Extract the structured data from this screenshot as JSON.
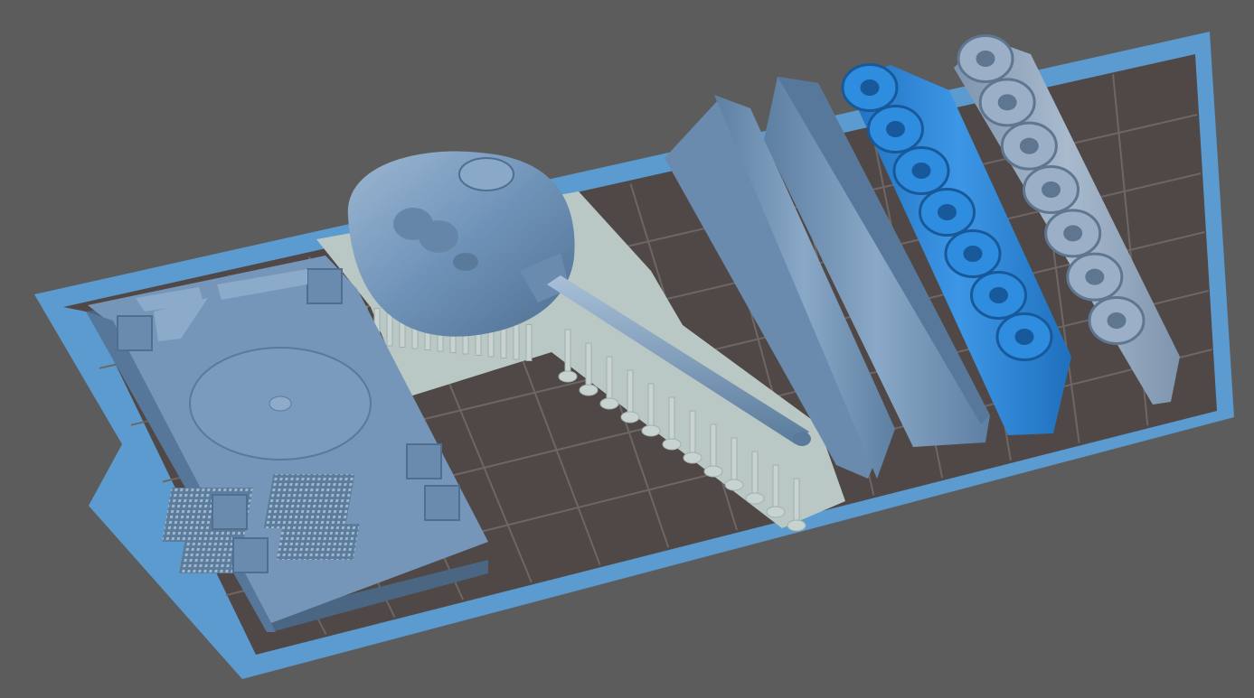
{
  "scene": {
    "background_color": "#5c5c5c",
    "build_plate": {
      "border_color": "#5b9bd0",
      "grid_color": "#4a4543",
      "grid_line_color": "#6e6664"
    },
    "models": [
      {
        "name": "hull",
        "color": "#6f93b8",
        "selected": false
      },
      {
        "name": "turret",
        "color": "#7198bf",
        "selected": false
      },
      {
        "name": "gun-barrel",
        "color": "#7198bf",
        "selected": false
      },
      {
        "name": "side-skirt-left",
        "color": "#6f93b8",
        "selected": false
      },
      {
        "name": "side-skirt-right",
        "color": "#6f93b8",
        "selected": false
      },
      {
        "name": "track-left",
        "color": "#2e86d6",
        "selected": true
      },
      {
        "name": "track-right",
        "color": "#8aa2bd",
        "selected": false
      }
    ],
    "support_raft_color": "#b9c8c4",
    "support_color": "#c8d2d0"
  }
}
